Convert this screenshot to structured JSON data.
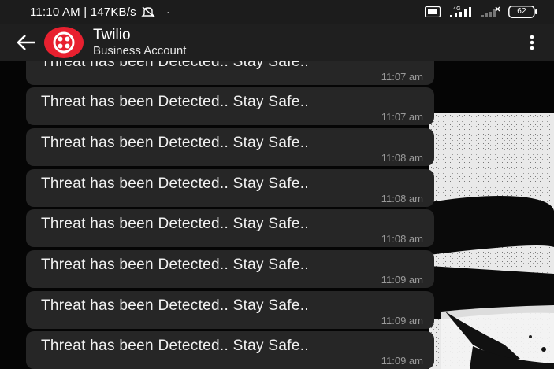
{
  "status_bar": {
    "time_speed": "11:10 AM | 147KB/s",
    "dot": "·",
    "network_label": "4G",
    "battery": "62"
  },
  "app_bar": {
    "contact_name": "Twilio",
    "contact_subtitle": "Business Account",
    "avatar_color": "#e8202f"
  },
  "messages": [
    {
      "text": "Threat has been Detected.. Stay Safe..",
      "time": "11:07 am"
    },
    {
      "text": "Threat has been Detected.. Stay Safe..",
      "time": "11:07 am"
    },
    {
      "text": "Threat has been Detected.. Stay Safe..",
      "time": "11:08 am"
    },
    {
      "text": "Threat has been Detected.. Stay Safe..",
      "time": "11:08 am"
    },
    {
      "text": "Threat has been Detected.. Stay Safe..",
      "time": "11:08 am"
    },
    {
      "text": "Threat has been Detected.. Stay Safe..",
      "time": "11:09 am"
    },
    {
      "text": "Threat has been Detected.. Stay Safe..",
      "time": "11:09 am"
    },
    {
      "text": "Threat has been Detected.. Stay Safe..",
      "time": "11:09 am"
    }
  ]
}
